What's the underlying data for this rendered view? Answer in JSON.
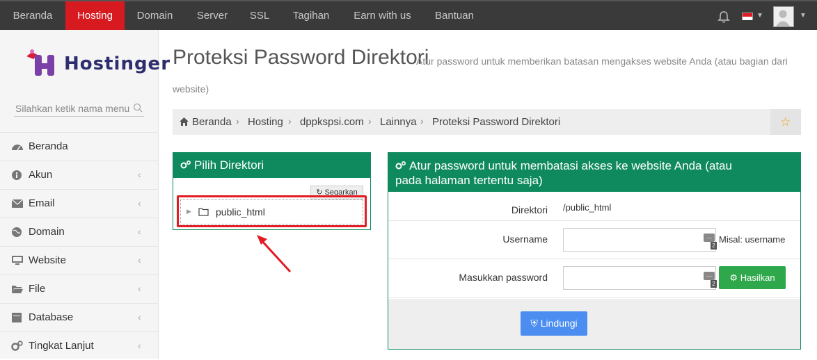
{
  "nav": {
    "items": [
      {
        "label": "Beranda",
        "active": false
      },
      {
        "label": "Hosting",
        "active": true
      },
      {
        "label": "Domain",
        "active": false
      },
      {
        "label": "Server",
        "active": false
      },
      {
        "label": "SSL",
        "active": false
      },
      {
        "label": "Tagihan",
        "active": false
      },
      {
        "label": "Earn with us",
        "active": false
      },
      {
        "label": "Bantuan",
        "active": false
      }
    ]
  },
  "sidebar": {
    "logo": "Hostinger",
    "search_placeholder": "Silahkan ketik nama menu",
    "items": [
      {
        "label": "Beranda",
        "icon": "dashboard-icon"
      },
      {
        "label": "Akun",
        "icon": "info-icon"
      },
      {
        "label": "Email",
        "icon": "envelope-icon"
      },
      {
        "label": "Domain",
        "icon": "globe-icon"
      },
      {
        "label": "Website",
        "icon": "monitor-icon"
      },
      {
        "label": "File",
        "icon": "folder-open-icon"
      },
      {
        "label": "Database",
        "icon": "database-icon"
      },
      {
        "label": "Tingkat Lanjut",
        "icon": "cogs-icon"
      }
    ]
  },
  "page": {
    "title": "Proteksi Password Direktori",
    "subtitle_line1": "Atur password untuk memberikan batasan mengakses website Anda (atau bagian dari",
    "subtitle_line2": "website)"
  },
  "breadcrumb": [
    "Beranda",
    "Hosting",
    "dppkspsi.com",
    "Lainnya",
    "Proteksi Password Direktori"
  ],
  "left_panel": {
    "title": "Pilih Direktori",
    "refresh_label": "Segarkan",
    "directory": "public_html"
  },
  "right_panel": {
    "title_line1": "Atur password untuk membatasi akses ke website Anda (atau",
    "title_line2": "pada halaman tertentu saja)",
    "directory_label": "Direktori",
    "directory_value": "/public_html",
    "username_label": "Username",
    "username_value": "",
    "username_hint": "Misal: username",
    "password_label": "Masukkan password",
    "password_value": "",
    "generate_label": "Hasilkan",
    "protect_label": "Lindungi",
    "dots_badge": "2"
  },
  "colors": {
    "nav_bg": "#3a3a3a",
    "nav_active": "#d71920",
    "panel_green": "#0f8a5f",
    "generate_green": "#2ea84a",
    "protect_blue": "#4b8df0",
    "highlight_red": "#e11c24"
  }
}
